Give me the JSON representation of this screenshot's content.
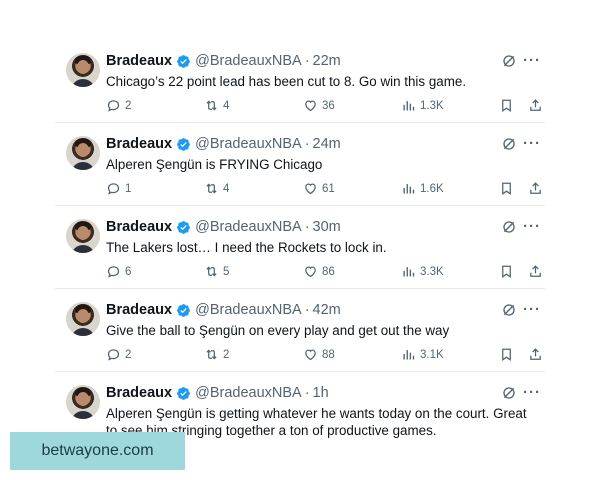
{
  "tweets": [
    {
      "name": "Bradeaux",
      "handle": "@BradeauxNBA",
      "time": "22m",
      "text": "Chicago’s 22 point lead has been cut to 8. Go win this game.",
      "replies": "2",
      "retweets": "4",
      "likes": "36",
      "views": "1.3K"
    },
    {
      "name": "Bradeaux",
      "handle": "@BradeauxNBA",
      "time": "24m",
      "text": "Alperen Şengün is FRYING Chicago",
      "replies": "1",
      "retweets": "4",
      "likes": "61",
      "views": "1.6K"
    },
    {
      "name": "Bradeaux",
      "handle": "@BradeauxNBA",
      "time": "30m",
      "text": "The Lakers lost… I need the Rockets to lock in.",
      "replies": "6",
      "retweets": "5",
      "likes": "86",
      "views": "3.3K"
    },
    {
      "name": "Bradeaux",
      "handle": "@BradeauxNBA",
      "time": "42m",
      "text": "Give the ball to Şengün on every play and get out the way",
      "replies": "2",
      "retweets": "2",
      "likes": "88",
      "views": "3.1K"
    },
    {
      "name": "Bradeaux",
      "handle": "@BradeauxNBA",
      "time": "1h",
      "text": "Alperen Şengün is getting whatever he wants today on the court. Great to see him stringing together a ton of productive games.",
      "replies": "",
      "retweets": "",
      "likes": "",
      "views": ""
    }
  ],
  "separator": "·",
  "watermark": "betwayone.com",
  "colors": {
    "verified": "#1d9bf0",
    "secondary_text": "#536471",
    "watermark_bg": "#9fd8dc"
  }
}
